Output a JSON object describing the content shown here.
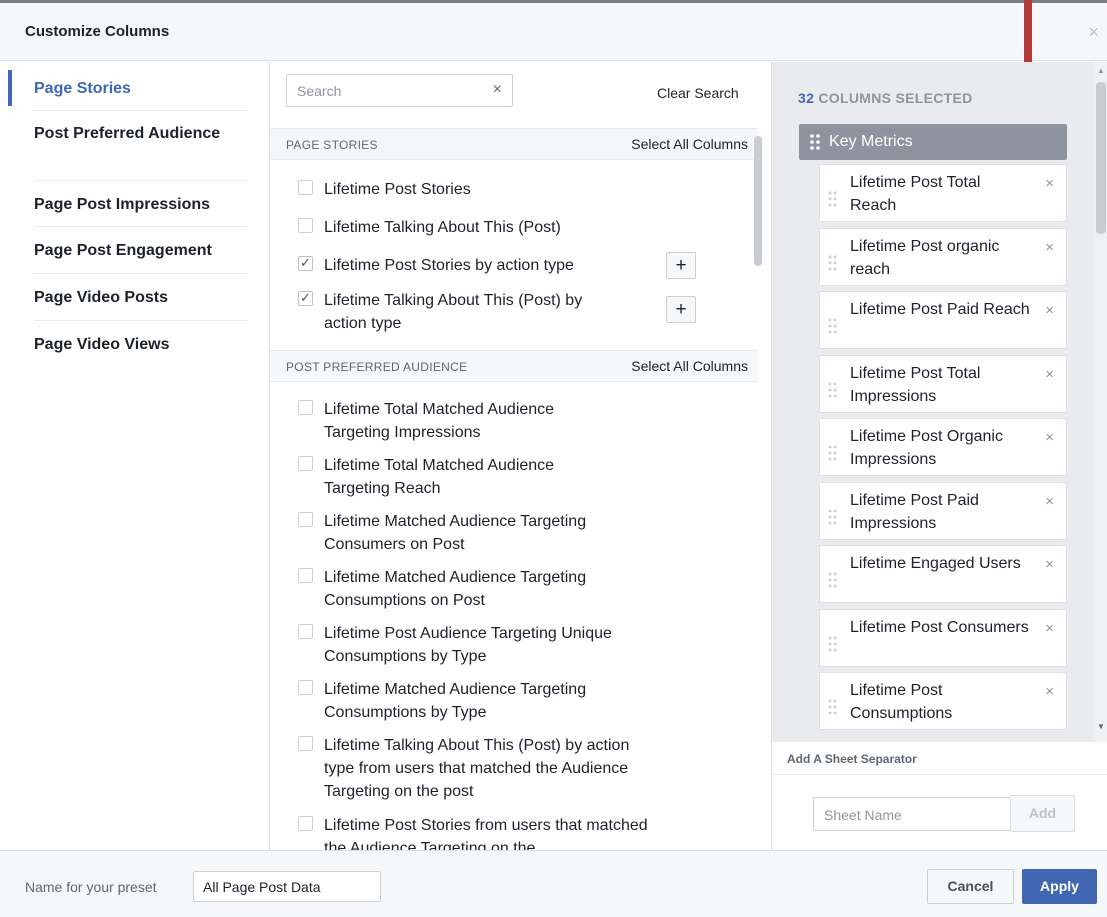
{
  "dialog": {
    "title": "Customize Columns"
  },
  "sidebar": {
    "items": [
      {
        "label": "Page Stories",
        "active": true
      },
      {
        "label": "Post Preferred Audience",
        "active": false
      },
      {
        "label": "Page Post Impressions",
        "active": false
      },
      {
        "label": "Page Post Engagement",
        "active": false
      },
      {
        "label": "Page Video Posts",
        "active": false
      },
      {
        "label": "Page Video Views",
        "active": false
      }
    ]
  },
  "search": {
    "placeholder": "Search",
    "value": "",
    "clear_label": "Clear Search"
  },
  "sections": [
    {
      "title": "PAGE STORIES",
      "select_all_label": "Select All Columns",
      "options": [
        {
          "label": "Lifetime Post Stories",
          "checked": false,
          "has_add": false
        },
        {
          "label": "Lifetime Talking About This (Post)",
          "checked": false,
          "has_add": false
        },
        {
          "label": "Lifetime Post Stories by action type",
          "checked": true,
          "has_add": true
        },
        {
          "label": "Lifetime Talking About This (Post) by action type",
          "checked": true,
          "has_add": true
        }
      ]
    },
    {
      "title": "POST PREFERRED AUDIENCE",
      "select_all_label": "Select All Columns",
      "options": [
        {
          "label": "Lifetime Total Matched Audience Targeting Impressions",
          "checked": false
        },
        {
          "label": "Lifetime Total Matched Audience Targeting Reach",
          "checked": false
        },
        {
          "label": "Lifetime Matched Audience Targeting Consumers on Post",
          "checked": false
        },
        {
          "label": "Lifetime Matched Audience Targeting Consumptions on Post",
          "checked": false
        },
        {
          "label": "Lifetime Post Audience Targeting Unique Consumptions by Type",
          "checked": false
        },
        {
          "label": "Lifetime Matched Audience Targeting Consumptions by Type",
          "checked": false
        },
        {
          "label": "Lifetime Talking About This (Post) by action type from users that matched the Audience Targeting on the post",
          "checked": false
        },
        {
          "label": "Lifetime Post Stories from users that matched the Audience Targeting on the",
          "checked": false
        }
      ]
    }
  ],
  "selected": {
    "count": "32",
    "count_suffix": "COLUMNS SELECTED",
    "group_title": "Key Metrics",
    "metrics": [
      "Lifetime Post Total Reach",
      "Lifetime Post organic reach",
      "Lifetime Post Paid Reach",
      "Lifetime Post Total Impressions",
      "Lifetime Post Organic Impressions",
      "Lifetime Post Paid Impressions",
      "Lifetime Engaged Users",
      "Lifetime Post Consumers",
      "Lifetime Post Consumptions"
    ],
    "remove_glyph": "×"
  },
  "separator": {
    "label": "Add A Sheet Separator",
    "placeholder": "Sheet Name",
    "add_label": "Add"
  },
  "footer": {
    "preset_label": "Name for your preset",
    "preset_value": "All Page Post Data",
    "cancel_label": "Cancel",
    "apply_label": "Apply"
  },
  "glyphs": {
    "close": "×",
    "plus": "+",
    "check": "✓",
    "scroll_up": "▲",
    "scroll_down": "▼"
  },
  "colors": {
    "accent": "#4267b2",
    "arrow": "#b03a3a",
    "group_header": "#8d949e"
  }
}
